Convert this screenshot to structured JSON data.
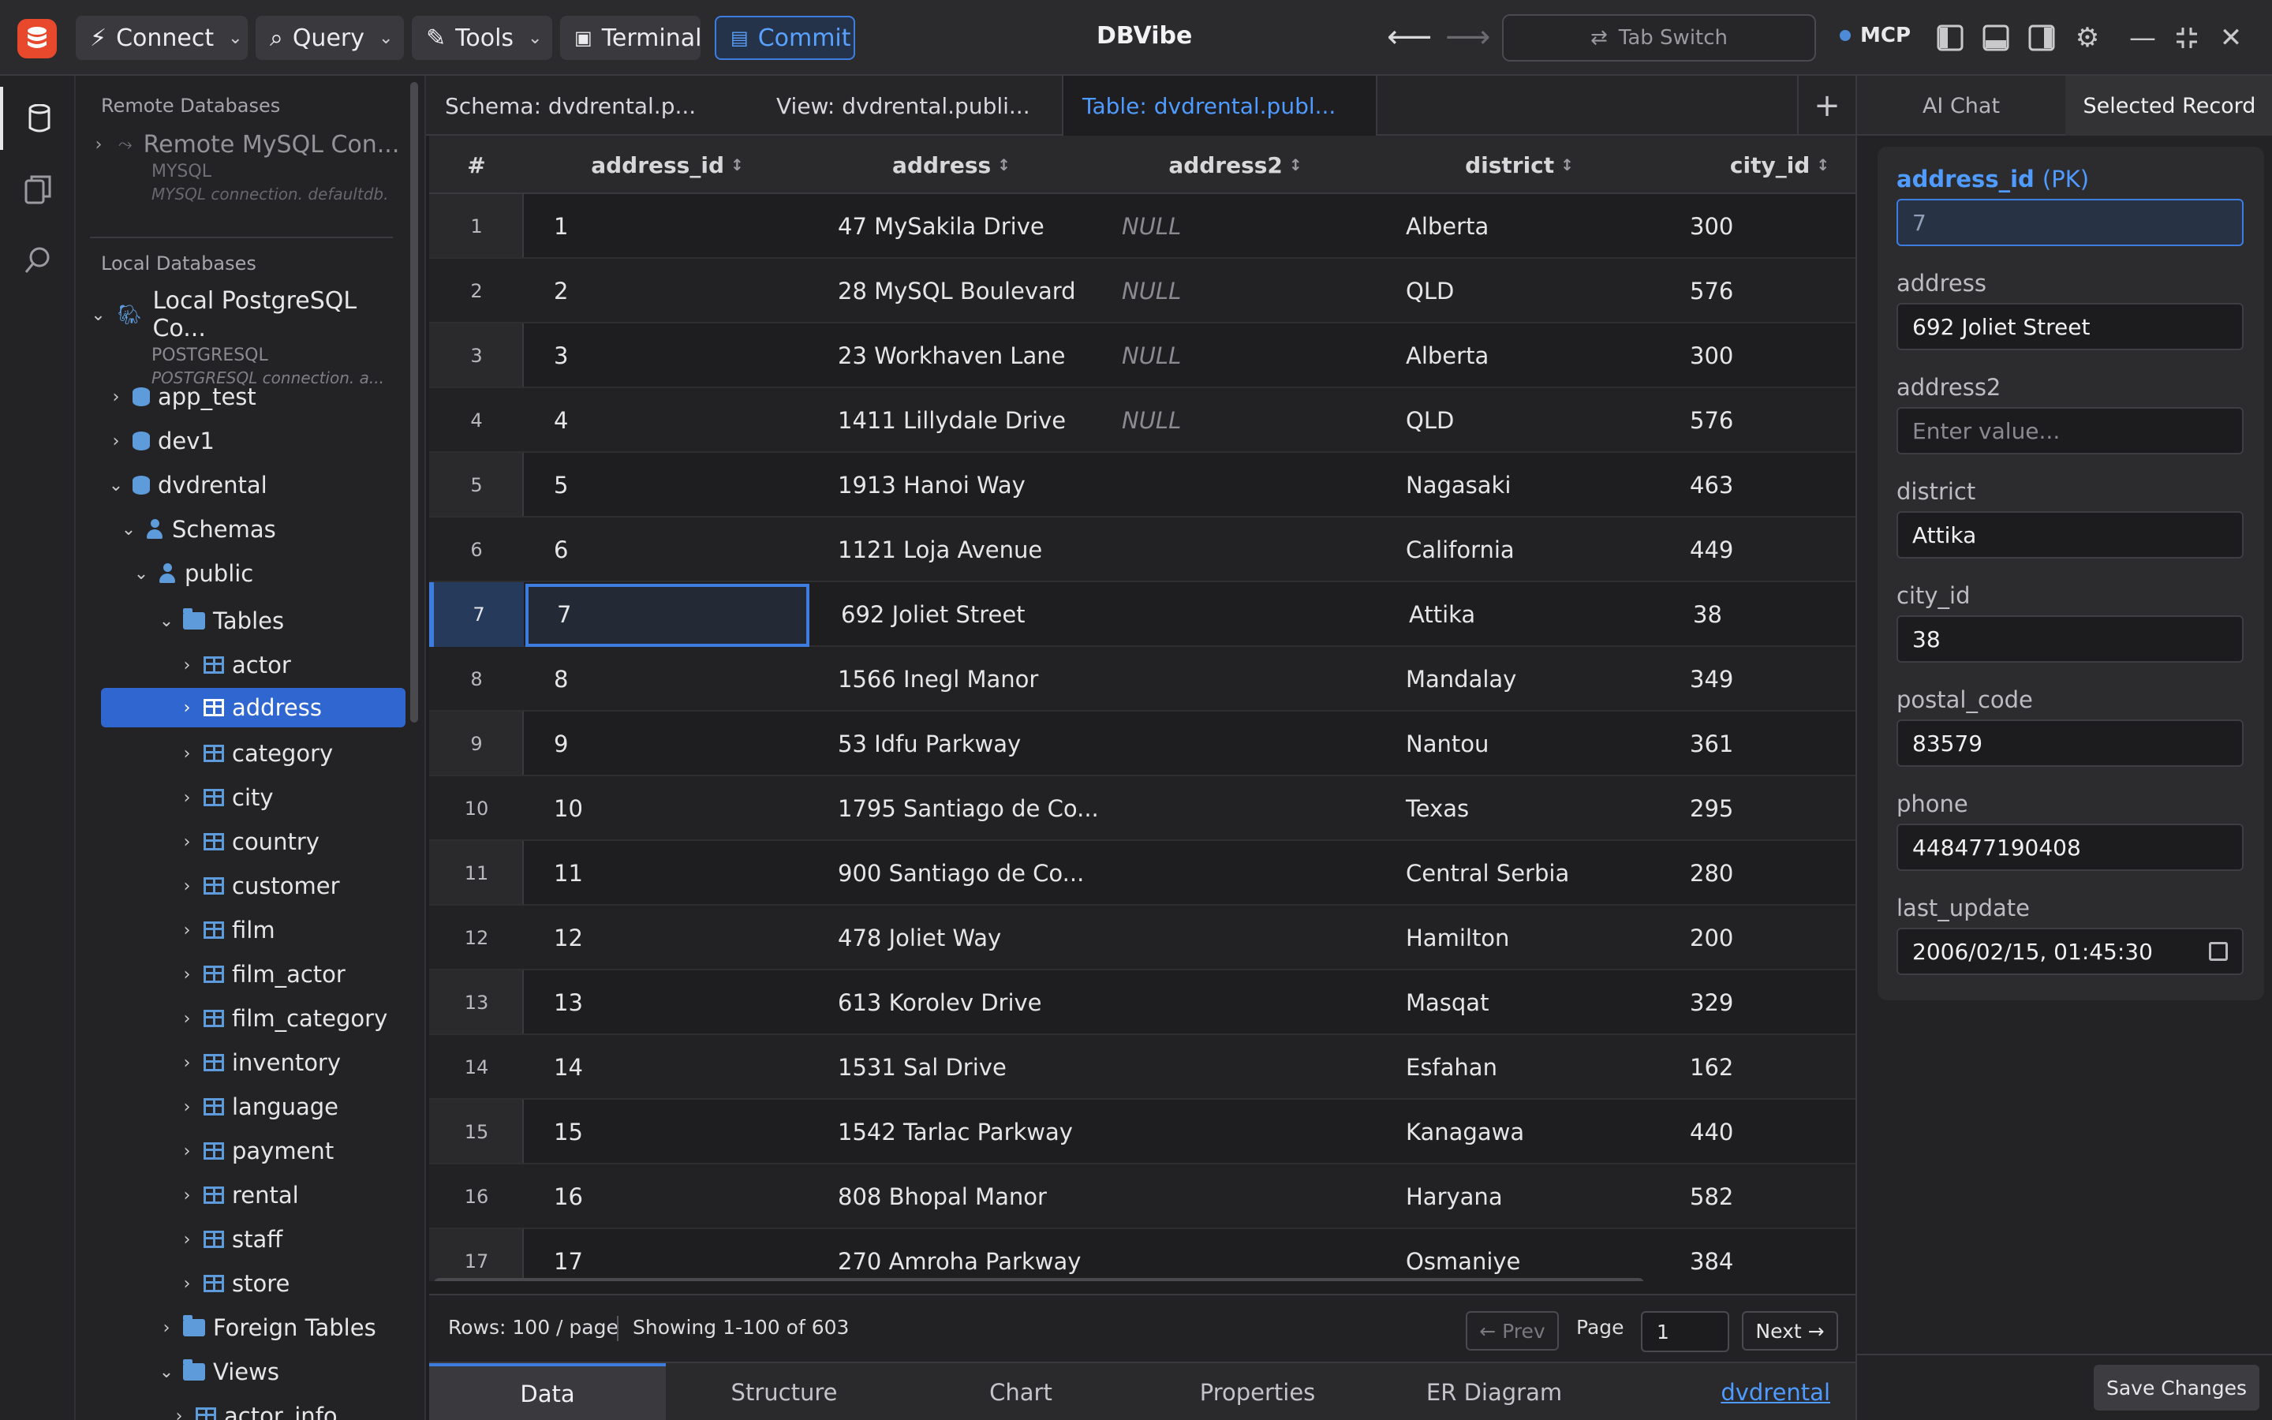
{
  "titlebar": {
    "connect": "Connect",
    "query": "Query",
    "tools": "Tools",
    "terminal": "Terminal",
    "commit": "Commit",
    "app_title": "DBVibe",
    "tab_switch": "Tab Switch",
    "mcp": "MCP"
  },
  "sidebar": {
    "remote_title": "Remote Databases",
    "remote_conn": {
      "name": "Remote MySQL Con...",
      "type": "MYSQL",
      "desc": "MYSQL connection. defaultdb."
    },
    "local_title": "Local Databases",
    "local_conn": {
      "name": "Local PostgreSQL Co...",
      "type": "POSTGRESQL",
      "desc": "POSTGRESQL connection. a..."
    },
    "tree": [
      {
        "label": "app_test"
      },
      {
        "label": "dev1"
      },
      {
        "label": "dvdrental"
      },
      {
        "label": "Schemas"
      },
      {
        "label": "public"
      },
      {
        "label": "Tables"
      },
      {
        "label": "actor"
      },
      {
        "label": "address"
      },
      {
        "label": "category"
      },
      {
        "label": "city"
      },
      {
        "label": "country"
      },
      {
        "label": "customer"
      },
      {
        "label": "film"
      },
      {
        "label": "film_actor"
      },
      {
        "label": "film_category"
      },
      {
        "label": "inventory"
      },
      {
        "label": "language"
      },
      {
        "label": "payment"
      },
      {
        "label": "rental"
      },
      {
        "label": "staff"
      },
      {
        "label": "store"
      },
      {
        "label": "Foreign Tables"
      },
      {
        "label": "Views"
      },
      {
        "label": "actor_info"
      }
    ]
  },
  "tabs": [
    {
      "label": "Schema: dvdrental.p..."
    },
    {
      "label": "View: dvdrental.publi..."
    },
    {
      "label": "Table: dvdrental.publ..."
    }
  ],
  "grid": {
    "rownum_header": "#",
    "columns": [
      "address_id",
      "address",
      "address2",
      "district",
      "city_id"
    ],
    "rows": [
      [
        "1",
        "1",
        "47 MySakila Drive",
        "NULL",
        "Alberta",
        "300"
      ],
      [
        "2",
        "2",
        "28 MySQL Boulevard",
        "NULL",
        "QLD",
        "576"
      ],
      [
        "3",
        "3",
        "23 Workhaven Lane",
        "NULL",
        "Alberta",
        "300"
      ],
      [
        "4",
        "4",
        "1411 Lillydale Drive",
        "NULL",
        "QLD",
        "576"
      ],
      [
        "5",
        "5",
        "1913 Hanoi Way",
        "",
        "Nagasaki",
        "463"
      ],
      [
        "6",
        "6",
        "1121 Loja Avenue",
        "",
        "California",
        "449"
      ],
      [
        "7",
        "7",
        "692 Joliet Street",
        "",
        "Attika",
        "38"
      ],
      [
        "8",
        "8",
        "1566 Inegl Manor",
        "",
        "Mandalay",
        "349"
      ],
      [
        "9",
        "9",
        "53 Idfu Parkway",
        "",
        "Nantou",
        "361"
      ],
      [
        "10",
        "10",
        "1795 Santiago de Co...",
        "",
        "Texas",
        "295"
      ],
      [
        "11",
        "11",
        "900 Santiago de Co...",
        "",
        "Central Serbia",
        "280"
      ],
      [
        "12",
        "12",
        "478 Joliet Way",
        "",
        "Hamilton",
        "200"
      ],
      [
        "13",
        "13",
        "613 Korolev Drive",
        "",
        "Masqat",
        "329"
      ],
      [
        "14",
        "14",
        "1531 Sal Drive",
        "",
        "Esfahan",
        "162"
      ],
      [
        "15",
        "15",
        "1542 Tarlac Parkway",
        "",
        "Kanagawa",
        "440"
      ],
      [
        "16",
        "16",
        "808 Bhopal Manor",
        "",
        "Haryana",
        "582"
      ],
      [
        "17",
        "17",
        "270 Amroha Parkway",
        "",
        "Osmaniye",
        "384"
      ]
    ]
  },
  "pager": {
    "rows": "Rows: 100 / page",
    "showing": "Showing 1-100 of 603",
    "prev": "← Prev",
    "page_label": "Page",
    "page_value": "1",
    "next": "Next →"
  },
  "bottom_tabs": [
    "Data",
    "Structure",
    "Chart",
    "Properties",
    "ER Diagram"
  ],
  "db_link": "dvdrental",
  "right_panel": {
    "tabs": [
      "AI Chat",
      "Selected Record"
    ],
    "pk_suffix": "(PK)",
    "fields": [
      {
        "label": "address_id",
        "value": "7"
      },
      {
        "label": "address",
        "value": "692 Joliet Street"
      },
      {
        "label": "address2",
        "value": "",
        "placeholder": "Enter value..."
      },
      {
        "label": "district",
        "value": "Attika"
      },
      {
        "label": "city_id",
        "value": "38"
      },
      {
        "label": "postal_code",
        "value": "83579"
      },
      {
        "label": "phone",
        "value": "448477190408"
      },
      {
        "label": "last_update",
        "value": "2006/02/15, 01:45:30"
      }
    ],
    "save": "Save Changes"
  },
  "colors": {
    "accent": "#3e7de0",
    "link": "#4f9bff",
    "logo": "#e8492c",
    "selected": "#2f66d0"
  }
}
